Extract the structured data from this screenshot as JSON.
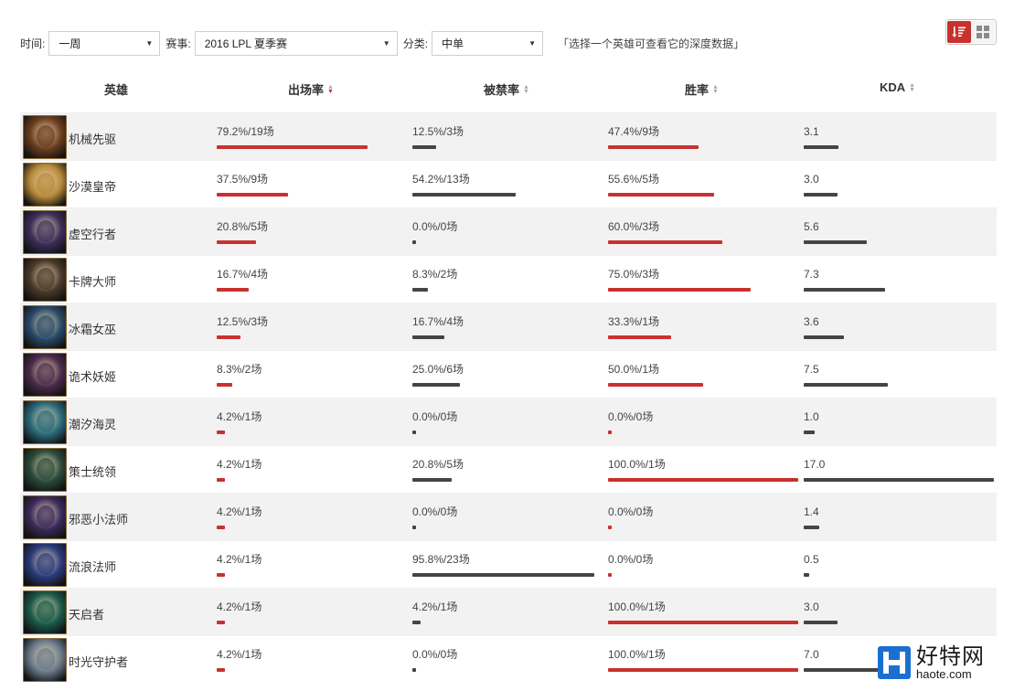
{
  "filters": {
    "time_label": "时间:",
    "time_value": "一周",
    "event_label": "赛事:",
    "event_value": "2016 LPL 夏季赛",
    "category_label": "分类:",
    "category_value": "中单",
    "hint": "「选择一个英雄可查看它的深度数据」"
  },
  "view_toggle": {
    "list_icon": "list-sort-icon",
    "grid_icon": "grid-icon",
    "active": "list"
  },
  "columns": {
    "hero": "英雄",
    "pick": "出场率",
    "ban": "被禁率",
    "win": "胜率",
    "kda": "KDA",
    "sorted_by": "pick",
    "sort_direction": "desc"
  },
  "colors": {
    "accent": "#c8312e",
    "dark_bar": "#444444",
    "stripe": "#f2f2f2"
  },
  "heroes": [
    {
      "name": "机械先驱",
      "pick": "79.2%/19场",
      "pick_pct": 79.2,
      "ban": "12.5%/3场",
      "ban_pct": 12.5,
      "win": "47.4%/9场",
      "win_pct": 47.4,
      "kda": "3.1",
      "kda_value": 3.1,
      "avatar_color": "#6b3d1e"
    },
    {
      "name": "沙漠皇帝",
      "pick": "37.5%/9场",
      "pick_pct": 37.5,
      "ban": "54.2%/13场",
      "ban_pct": 54.2,
      "win": "55.6%/5场",
      "win_pct": 55.6,
      "kda": "3.0",
      "kda_value": 3.0,
      "avatar_color": "#b88a3a"
    },
    {
      "name": "虚空行者",
      "pick": "20.8%/5场",
      "pick_pct": 20.8,
      "ban": "0.0%/0场",
      "ban_pct": 0,
      "win": "60.0%/3场",
      "win_pct": 60.0,
      "kda": "5.6",
      "kda_value": 5.6,
      "avatar_color": "#3b2d5a"
    },
    {
      "name": "卡牌大师",
      "pick": "16.7%/4场",
      "pick_pct": 16.7,
      "ban": "8.3%/2场",
      "ban_pct": 8.3,
      "win": "75.0%/3场",
      "win_pct": 75.0,
      "kda": "7.3",
      "kda_value": 7.3,
      "avatar_color": "#4a3a2a"
    },
    {
      "name": "冰霜女巫",
      "pick": "12.5%/3场",
      "pick_pct": 12.5,
      "ban": "16.7%/4场",
      "ban_pct": 16.7,
      "win": "33.3%/1场",
      "win_pct": 33.3,
      "kda": "3.6",
      "kda_value": 3.6,
      "avatar_color": "#2a4a6a"
    },
    {
      "name": "诡术妖姬",
      "pick": "8.3%/2场",
      "pick_pct": 8.3,
      "ban": "25.0%/6场",
      "ban_pct": 25.0,
      "win": "50.0%/1场",
      "win_pct": 50.0,
      "kda": "7.5",
      "kda_value": 7.5,
      "avatar_color": "#4a2a4a"
    },
    {
      "name": "潮汐海灵",
      "pick": "4.2%/1场",
      "pick_pct": 4.2,
      "ban": "0.0%/0场",
      "ban_pct": 0,
      "win": "0.0%/0场",
      "win_pct": 0,
      "kda": "1.0",
      "kda_value": 1.0,
      "avatar_color": "#2a6a7a"
    },
    {
      "name": "策士统领",
      "pick": "4.2%/1场",
      "pick_pct": 4.2,
      "ban": "20.8%/5场",
      "ban_pct": 20.8,
      "win": "100.0%/1场",
      "win_pct": 100.0,
      "kda": "17.0",
      "kda_value": 17.0,
      "avatar_color": "#2a4a3a"
    },
    {
      "name": "邪恶小法师",
      "pick": "4.2%/1场",
      "pick_pct": 4.2,
      "ban": "0.0%/0场",
      "ban_pct": 0,
      "win": "0.0%/0场",
      "win_pct": 0,
      "kda": "1.4",
      "kda_value": 1.4,
      "avatar_color": "#3a2a5a"
    },
    {
      "name": "流浪法师",
      "pick": "4.2%/1场",
      "pick_pct": 4.2,
      "ban": "95.8%/23场",
      "ban_pct": 95.8,
      "win": "0.0%/0场",
      "win_pct": 0,
      "kda": "0.5",
      "kda_value": 0.5,
      "avatar_color": "#2a3a7a"
    },
    {
      "name": "天启者",
      "pick": "4.2%/1场",
      "pick_pct": 4.2,
      "ban": "4.2%/1场",
      "ban_pct": 4.2,
      "win": "100.0%/1场",
      "win_pct": 100.0,
      "kda": "3.0",
      "kda_value": 3.0,
      "avatar_color": "#1a5a4a"
    },
    {
      "name": "时光守护者",
      "pick": "4.2%/1场",
      "pick_pct": 4.2,
      "ban": "0.0%/0场",
      "ban_pct": 0,
      "win": "100.0%/1场",
      "win_pct": 100.0,
      "kda": "7.0",
      "kda_value": 7.0,
      "avatar_color": "#6a7a8a"
    }
  ],
  "watermark": {
    "title": "好特网",
    "domain": "haote.com"
  }
}
